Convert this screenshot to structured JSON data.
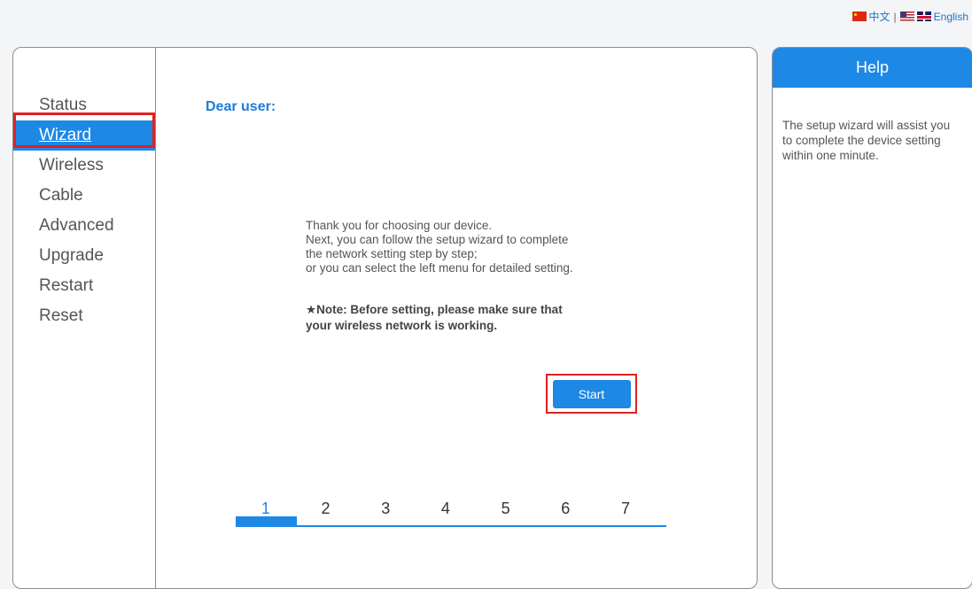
{
  "lang_bar": {
    "chinese_label": "中文",
    "separator": "|",
    "english_label": "English"
  },
  "menu": {
    "items": [
      {
        "label": "Status",
        "active": false
      },
      {
        "label": "Wizard",
        "active": true
      },
      {
        "label": "Wireless",
        "active": false
      },
      {
        "label": "Cable",
        "active": false
      },
      {
        "label": "Advanced",
        "active": false
      },
      {
        "label": "Upgrade",
        "active": false
      },
      {
        "label": "Restart",
        "active": false
      },
      {
        "label": "Reset",
        "active": false
      }
    ]
  },
  "content": {
    "greeting": "Dear user:",
    "intro_lines": [
      "Thank you for choosing our device.",
      "Next, you can follow the setup wizard to complete",
      "the network setting step by step;",
      "or you can select the left menu for detailed setting."
    ],
    "note_lines": [
      "★Note: Before setting, please make sure that",
      "your wireless network is working."
    ],
    "start_label": "Start",
    "steps": [
      "1",
      "2",
      "3",
      "4",
      "5",
      "6",
      "7"
    ],
    "current_step": 1
  },
  "help": {
    "title": "Help",
    "text": "The setup wizard will assist you to complete the device setting within one minute."
  },
  "colors": {
    "accent": "#1e88e5",
    "highlight_border": "#e02020",
    "greeting": "#1e7bd8"
  }
}
